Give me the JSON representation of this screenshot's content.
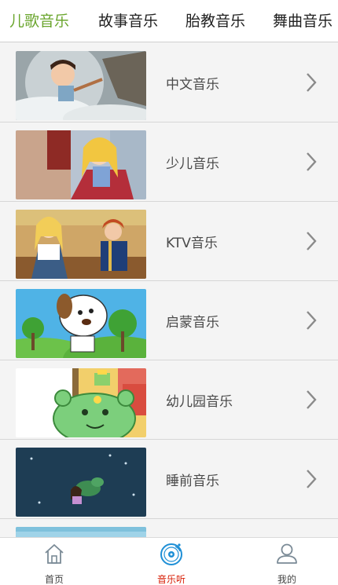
{
  "tabs": [
    {
      "label": "儿歌音乐",
      "active": true
    },
    {
      "label": "故事音乐",
      "active": false
    },
    {
      "label": "胎教音乐",
      "active": false
    },
    {
      "label": "舞曲音乐",
      "active": false
    }
  ],
  "list": {
    "items": [
      {
        "label": "中文音乐"
      },
      {
        "label": "少儿音乐"
      },
      {
        "label": "KTV音乐"
      },
      {
        "label": "启蒙音乐"
      },
      {
        "label": "幼儿园音乐"
      },
      {
        "label": "睡前音乐"
      }
    ]
  },
  "bottom_nav": {
    "items": [
      {
        "label": "首页",
        "icon": "home-icon",
        "active": false
      },
      {
        "label": "音乐听",
        "icon": "music-disc-icon",
        "active": true
      },
      {
        "label": "我的",
        "icon": "user-icon",
        "active": false
      }
    ]
  },
  "colors": {
    "accent_green": "#6aa52d",
    "active_red": "#d81e06",
    "disc_blue": "#1e8fd6"
  }
}
